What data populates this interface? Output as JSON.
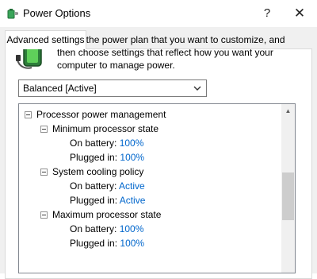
{
  "window": {
    "title": "Power Options",
    "help_label": "?",
    "close_label": "✕"
  },
  "tab": {
    "label": "Advanced settings"
  },
  "description": "Select the power plan that you want to customize, and then choose settings that reflect how you want your computer to manage power.",
  "plan_select": {
    "value": "Balanced [Active]"
  },
  "tree": {
    "processor": {
      "label": "Processor power management"
    },
    "min_state": {
      "label": "Minimum processor state",
      "on_battery_label": "On battery:",
      "on_battery_value": "100%",
      "plugged_label": "Plugged in:",
      "plugged_value": "100%"
    },
    "cooling": {
      "label": "System cooling policy",
      "on_battery_label": "On battery:",
      "on_battery_value": "Active",
      "plugged_label": "Plugged in:",
      "plugged_value": "Active"
    },
    "max_state": {
      "label": "Maximum processor state",
      "on_battery_label": "On battery:",
      "on_battery_value": "100%",
      "plugged_label": "Plugged in:",
      "plugged_value": "100%"
    }
  },
  "colors": {
    "link": "#0066cc",
    "window_bg": "#f0f0f0"
  },
  "icons": {
    "app": "power-options-icon",
    "battery": "battery-plug-icon"
  }
}
